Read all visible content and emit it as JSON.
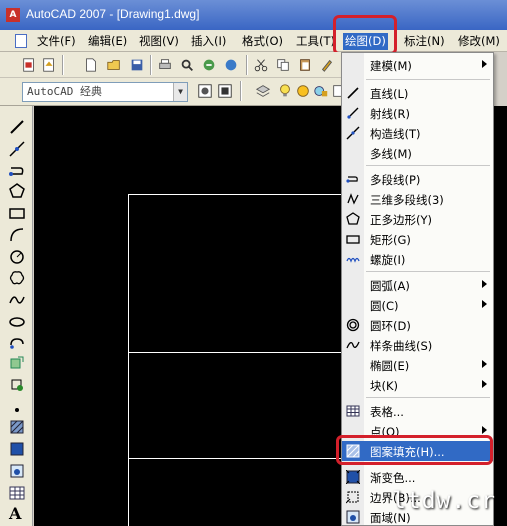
{
  "window": {
    "title": "AutoCAD 2007 - [Drawing1.dwg]",
    "icon": "autocad-app-icon",
    "title_color_start": "#6b8fd6",
    "title_color_end": "#3a66c4"
  },
  "menubar": {
    "items": [
      {
        "label": "文件(F)"
      },
      {
        "label": "编辑(E)"
      },
      {
        "label": "视图(V)"
      },
      {
        "label": "插入(I)"
      },
      {
        "label": "格式(O)"
      },
      {
        "label": "工具(T)"
      },
      {
        "label": "绘图(D)",
        "active": true
      },
      {
        "label": "标注(N)"
      },
      {
        "label": "修改(M)"
      }
    ]
  },
  "toolbar": {
    "workspace": "AutoCAD 经典"
  },
  "draw_menu": {
    "items": [
      {
        "label": "建模(M)",
        "submenu": true
      },
      {
        "label": "直线(L)",
        "icon": "line-icon"
      },
      {
        "label": "射线(R)",
        "icon": "ray-icon"
      },
      {
        "label": "构造线(T)",
        "icon": "xline-icon"
      },
      {
        "label": "多线(M)"
      },
      {
        "label": "多段线(P)",
        "icon": "polyline-icon"
      },
      {
        "label": "三维多段线(3)",
        "icon": "3d-polyline-icon"
      },
      {
        "label": "正多边形(Y)",
        "icon": "polygon-icon"
      },
      {
        "label": "矩形(G)",
        "icon": "rectangle-icon"
      },
      {
        "label": "螺旋(I)",
        "icon": "helix-icon"
      },
      {
        "label": "圆弧(A)",
        "submenu": true
      },
      {
        "label": "圆(C)",
        "submenu": true
      },
      {
        "label": "圆环(D)",
        "icon": "donut-icon"
      },
      {
        "label": "样条曲线(S)",
        "icon": "spline-icon"
      },
      {
        "label": "椭圆(E)",
        "submenu": true
      },
      {
        "label": "块(K)",
        "submenu": true
      },
      {
        "label": "表格...",
        "icon": "table-icon"
      },
      {
        "label": "点(O)",
        "submenu": true
      },
      {
        "label": "图案填充(H)...",
        "icon": "hatch-icon",
        "selected": true
      },
      {
        "label": "渐变色...",
        "icon": "gradient-icon"
      },
      {
        "label": "边界(B)...",
        "icon": "boundary-icon"
      },
      {
        "label": "面域(N)",
        "icon": "region-icon"
      }
    ]
  },
  "left_tools": {
    "text_tool": "A"
  },
  "watermark": "ltdw.cr",
  "colors": {
    "highlight": "#d4202b",
    "selection": "#316ac5",
    "canvas": "#000000"
  }
}
